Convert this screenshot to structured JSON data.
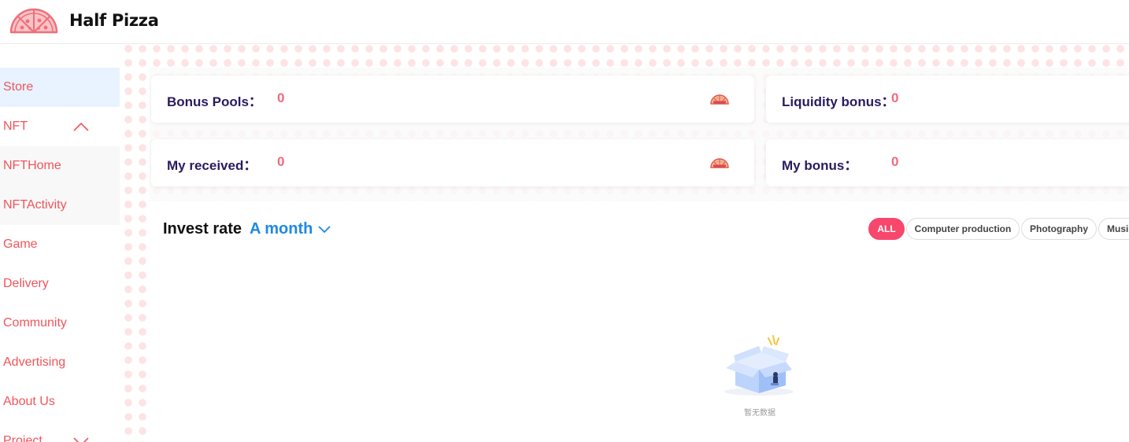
{
  "header": {
    "app_title": "Half Pizza",
    "logo_icon": "pizza-logo-icon"
  },
  "sidebar": {
    "items": [
      {
        "label": "Store"
      },
      {
        "label": "NFT",
        "chevron": "chevron-up-icon"
      },
      {
        "label": "NFTHome"
      },
      {
        "label": "NFTActivity"
      },
      {
        "label": "Game"
      },
      {
        "label": "Delivery"
      },
      {
        "label": "Community"
      },
      {
        "label": "Advertising"
      },
      {
        "label": "About Us"
      },
      {
        "label": "Project",
        "chevron": "chevron-down-icon"
      }
    ]
  },
  "stats": {
    "bonus_pools": {
      "label": "Bonus Pools：",
      "value": "0",
      "icon": "half-pizza-icon"
    },
    "liquidity_bonus": {
      "label": "Liquidity bonus：",
      "value": "0"
    },
    "my_received": {
      "label": "My received：",
      "value": "0",
      "icon": "half-pizza-icon"
    },
    "my_bonus": {
      "label": "My bonus：",
      "value": "0"
    }
  },
  "invest": {
    "title": "Invest rate",
    "period": "A month",
    "period_icon": "chevron-down-icon",
    "filters": [
      "ALL",
      "Computer production",
      "Photography",
      "Musi"
    ],
    "active_filter": "ALL",
    "empty_icon": "empty-box-icon",
    "empty_text": "暂无数据"
  },
  "colors": {
    "accent_red": "#f2545b",
    "value_pink": "#f16a7a",
    "link_blue": "#1e88e5",
    "chip_active": "#f7476c",
    "label_purple": "#2a1a5e",
    "dots": "#fde3e3"
  }
}
